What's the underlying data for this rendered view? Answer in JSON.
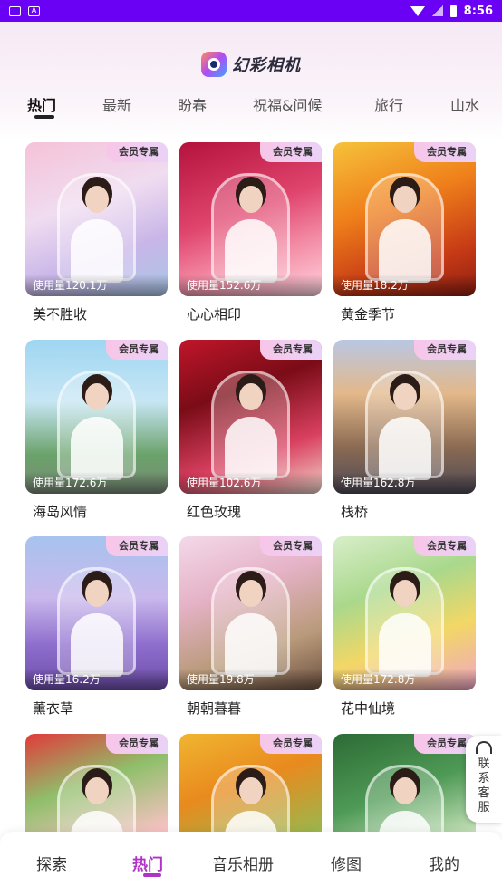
{
  "status_bar": {
    "time": "8:56",
    "left_icons": [
      "mail-icon",
      "app-a-icon"
    ]
  },
  "app": {
    "title": "幻彩相机"
  },
  "tabs": [
    {
      "label": "热门"
    },
    {
      "label": "最新"
    },
    {
      "label": "盼春"
    },
    {
      "label": "祝福&问候"
    },
    {
      "label": "旅行"
    },
    {
      "label": "山水"
    }
  ],
  "badge_label": "会员专属",
  "cards": [
    {
      "name": "美不胜收",
      "usage": "使用量120.1万",
      "bg": "linear-gradient(160deg,#f5c2d8 0%,#f0dcf0 40%,#c9b6e8 70%,#a8c6e6 100%)"
    },
    {
      "name": "心心相印",
      "usage": "使用量152.6万",
      "bg": "linear-gradient(160deg,#b4123c 0%,#e0456e 45%,#f38aa4 70%,#ffd4df 100%)"
    },
    {
      "name": "黄金季节",
      "usage": "使用量18.2万",
      "bg": "linear-gradient(160deg,#f6c23b 0%,#ef7f1a 40%,#c63a16 75%,#8e1e12 100%)"
    },
    {
      "name": "海岛风情",
      "usage": "使用量172.6万",
      "bg": "linear-gradient(180deg,#9fd6f2 0%,#c7e6f4 40%,#6aa26a 75%,#7a8a78 100%)"
    },
    {
      "name": "红色玫瑰",
      "usage": "使用量102.6万",
      "bg": "linear-gradient(160deg,#c0162a 0%,#7a0c17 35%,#d94060 70%,#f0d4c8 100%)"
    },
    {
      "name": "栈桥",
      "usage": "使用量162.8万",
      "bg": "linear-gradient(180deg,#b9c7e3 0%,#e3b88a 35%,#8a6a52 70%,#4f4a58 100%)"
    },
    {
      "name": "薰衣草",
      "usage": "使用量16.2万",
      "bg": "linear-gradient(180deg,#a7c3ee 0%,#c9b8ec 40%,#8f6fce 70%,#6d4da8 100%)"
    },
    {
      "name": "朝朝暮暮",
      "usage": "使用量19.8万",
      "bg": "linear-gradient(160deg,#f3d9e9 0%,#e5b2c6 35%,#b99a7a 70%,#6c5040 100%)"
    },
    {
      "name": "花中仙境",
      "usage": "使用量172.8万",
      "bg": "linear-gradient(160deg,#d8eec9 0%,#a9d88c 35%,#f2d766 65%,#f0a5c5 100%)"
    },
    {
      "name": "",
      "usage": "",
      "bg": "linear-gradient(160deg,#e23a3a 0%,#8fbf6a 35%,#f6c2c2 70%,#f7e0e0 100%)"
    },
    {
      "name": "",
      "usage": "",
      "bg": "linear-gradient(160deg,#f0b530 0%,#e98a1e 35%,#9fb44a 70%,#f6e3a8 100%)"
    },
    {
      "name": "",
      "usage": "",
      "bg": "linear-gradient(160deg,#2c6b35 0%,#4f9a56 40%,#cfe7c0 75%,#f5f5ee 100%)"
    }
  ],
  "bottom_nav": [
    {
      "label": "探索"
    },
    {
      "label": "热门"
    },
    {
      "label": "音乐相册"
    },
    {
      "label": "修图"
    },
    {
      "label": "我的"
    }
  ],
  "contact_service": {
    "label": "联系客服"
  },
  "colors": {
    "status_bar": "#6a00f4",
    "accent": "#b032c8"
  }
}
